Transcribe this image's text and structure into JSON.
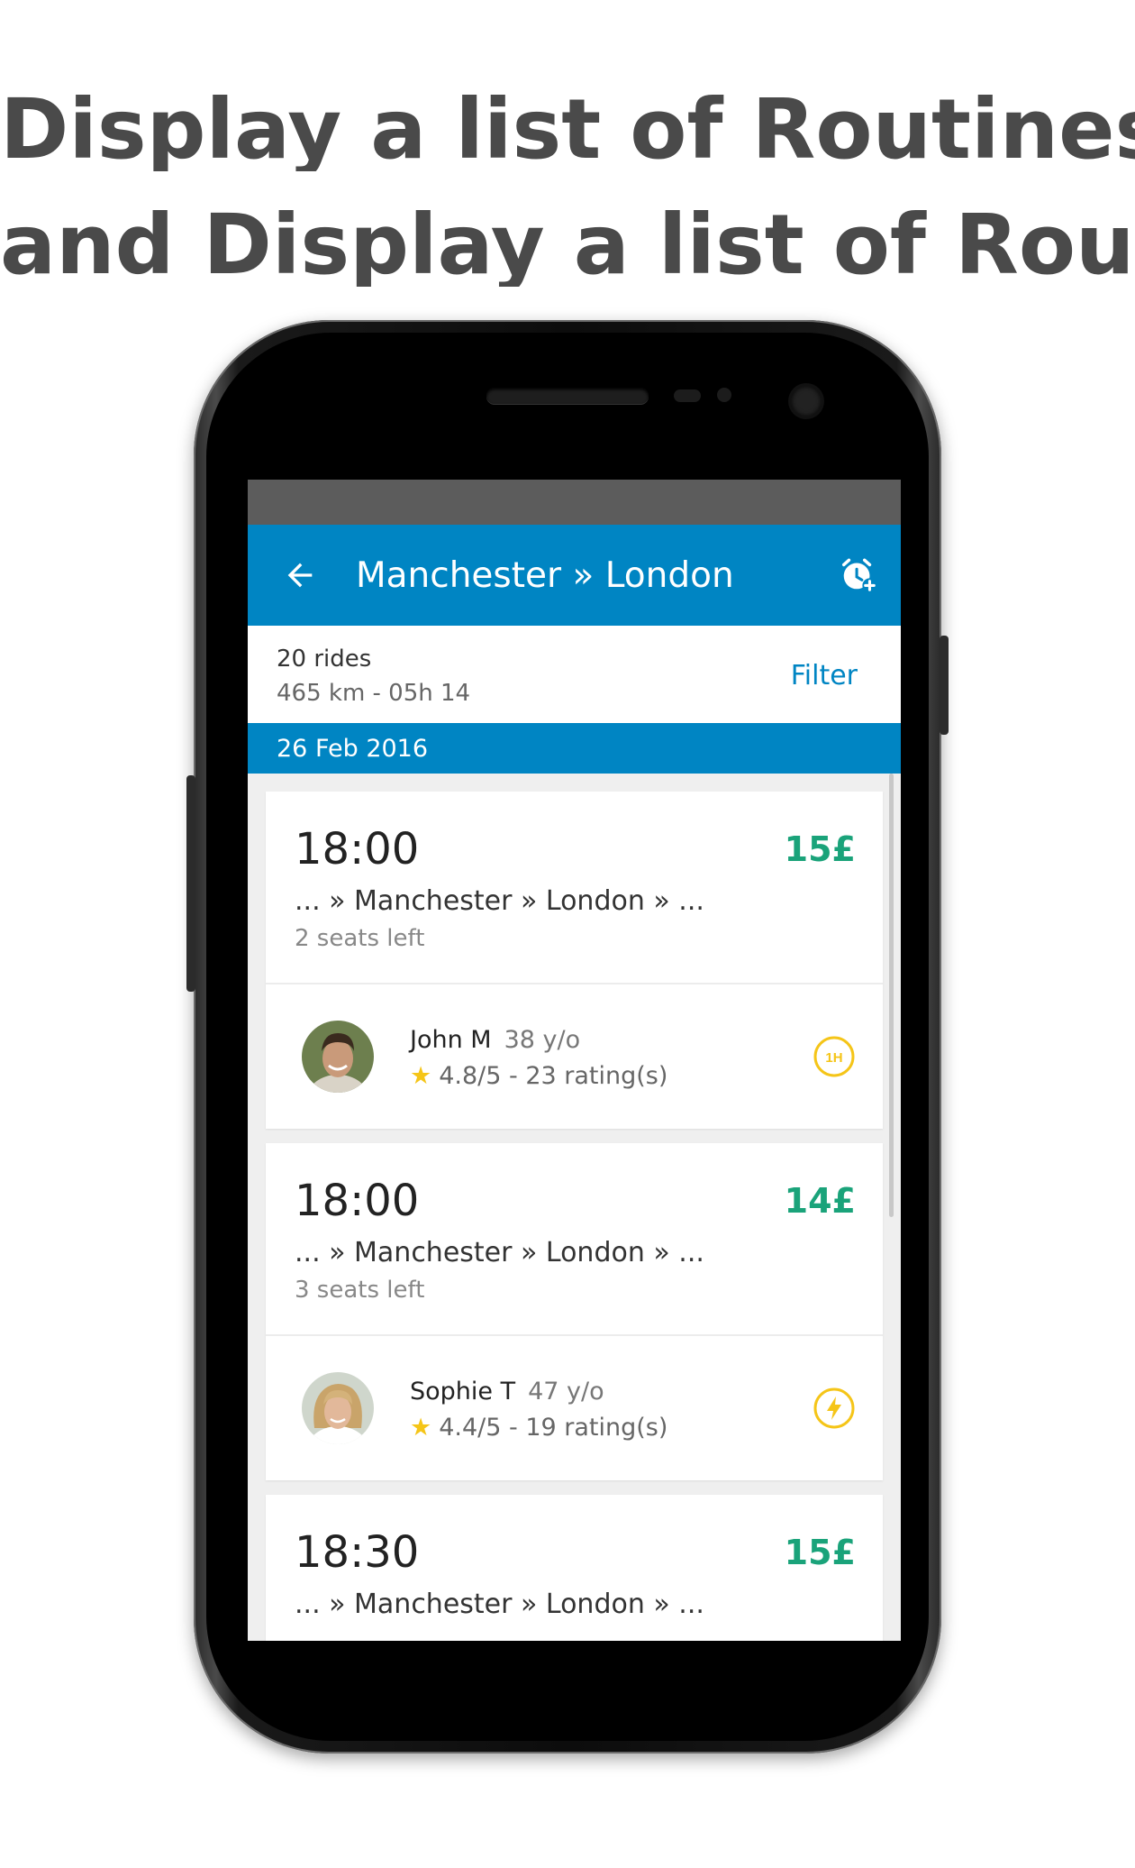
{
  "headline": {
    "line1": "Display a list of Routines",
    "line2": "and Display a list of Routines"
  },
  "app_bar": {
    "title": "Manchester » London",
    "back_icon": "arrow-left-icon",
    "action_icon": "alarm-add-icon"
  },
  "summary": {
    "rides": "20 rides",
    "distance": "465 km - 05h 14",
    "filter_label": "Filter"
  },
  "date": "26 Feb 2016",
  "colors": {
    "primary": "#0085c3",
    "price": "#1aa37a",
    "badge": "#f5c518"
  },
  "rides": [
    {
      "time": "18:00",
      "price": "15£",
      "route": "... » Manchester » London » ...",
      "seats": "2 seats left",
      "driver": {
        "name": "John M",
        "age": "38 y/o",
        "rating": "4.8/5 - 23 rating(s)",
        "badge": "1H"
      }
    },
    {
      "time": "18:00",
      "price": "14£",
      "route": "... » Manchester » London » ...",
      "seats": "3 seats left",
      "driver": {
        "name": "Sophie T",
        "age": "47 y/o",
        "rating": "4.4/5 - 19 rating(s)",
        "badge": "lightning-icon"
      }
    },
    {
      "time": "18:30",
      "price": "15£",
      "route": "... » Manchester » London » ..."
    }
  ]
}
